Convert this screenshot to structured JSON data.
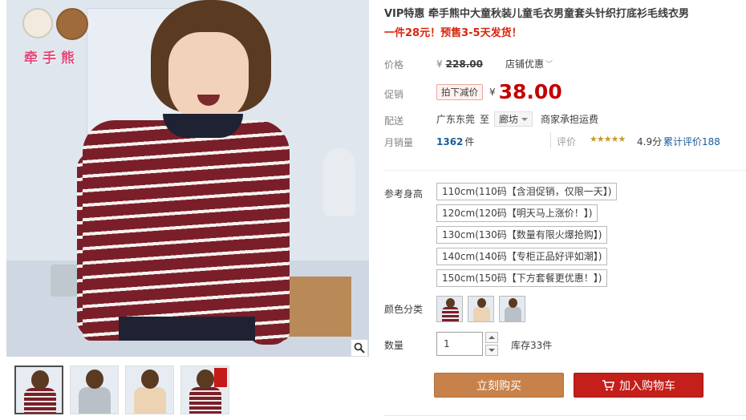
{
  "gallery": {
    "logo_text": "牵手熊",
    "thumbnails": [
      "red",
      "grey",
      "cream",
      "red-tag"
    ]
  },
  "product": {
    "title": "VIP特惠 牵手熊中大童秋装儿童毛衣男童套头针织打底衫毛线衣男",
    "subtitle": "一件28元！预售3-5天发货！"
  },
  "price": {
    "label": "价格",
    "currency": "¥",
    "original": "228.00",
    "shop_discount": "店铺优惠"
  },
  "promo": {
    "label": "促销",
    "tag": "拍下减价",
    "currency": "¥",
    "price": "38.00"
  },
  "delivery": {
    "label": "配送",
    "from": "广东东莞",
    "to_word": "至",
    "to": "廊坊",
    "freight": "商家承担运费"
  },
  "sales": {
    "label": "月销量",
    "count": "1362",
    "unit": "件",
    "rating_label": "评价",
    "stars": "★★★★★",
    "rating_value": 4.9,
    "score": "4.9分",
    "review_link": "累计评价188"
  },
  "sizes": {
    "label": "参考身高",
    "options": [
      "110cm(110码【含泪促销，仅限一天】)",
      "120cm(120码【明天马上涨价！】)",
      "130cm(130码【数量有限火爆抢购】)",
      "140cm(140码【专柜正品好评如潮】)",
      "150cm(150码【下方套餐更优惠！】)"
    ]
  },
  "colors": {
    "label": "颜色分类",
    "options": [
      {
        "name": "red-stripe",
        "color": "#7a1f2a"
      },
      {
        "name": "cream",
        "color": "#ecd3b3"
      },
      {
        "name": "grey",
        "color": "#b9c0c8"
      }
    ]
  },
  "quantity": {
    "label": "数量",
    "value": "1",
    "stock": "库存33件"
  },
  "actions": {
    "buy_now": "立刻购买",
    "add_to_cart": "加入购物车"
  },
  "theme": {
    "price_red": "#c40000",
    "buy_brown": "#c7824b",
    "cart_red": "#c41f1a",
    "link_blue": "#1a5d9b"
  }
}
